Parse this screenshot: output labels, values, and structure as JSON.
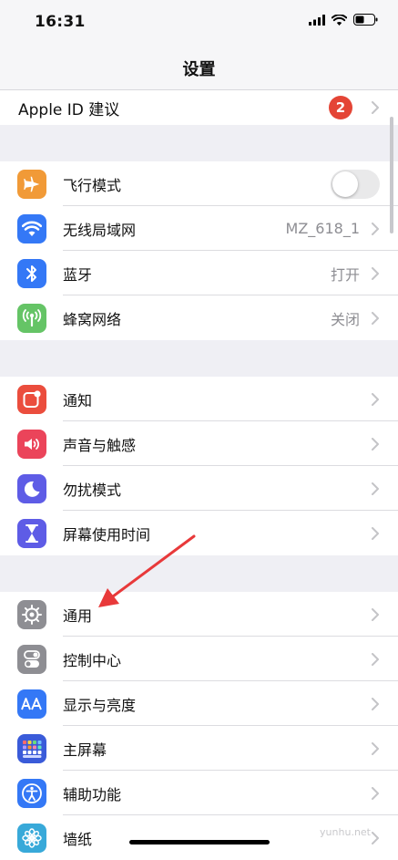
{
  "status_bar": {
    "time": "16:31"
  },
  "nav": {
    "title": "设置"
  },
  "top_row": {
    "label": "Apple ID 建议",
    "badge": "2"
  },
  "group1": [
    {
      "label": "飞行模式",
      "icon": "airplane-icon",
      "color": "#f19a37",
      "toggle": false
    },
    {
      "label": "无线局域网",
      "icon": "wifi-icon",
      "color": "#3478f6",
      "value": "MZ_618_1"
    },
    {
      "label": "蓝牙",
      "icon": "bluetooth-icon",
      "color": "#3478f6",
      "value": "打开"
    },
    {
      "label": "蜂窝网络",
      "icon": "cellular-icon",
      "color": "#65c466",
      "value": "关闭"
    }
  ],
  "group2": [
    {
      "label": "通知",
      "icon": "notification-icon",
      "color": "#eb4d3d"
    },
    {
      "label": "声音与触感",
      "icon": "sound-icon",
      "color": "#eb445a"
    },
    {
      "label": "勿扰模式",
      "icon": "moon-icon",
      "color": "#5e5ce6"
    },
    {
      "label": "屏幕使用时间",
      "icon": "hourglass-icon",
      "color": "#5e5ce6"
    }
  ],
  "group3": [
    {
      "label": "通用",
      "icon": "gear-icon",
      "color": "#8e8e93"
    },
    {
      "label": "控制中心",
      "icon": "toggles-icon",
      "color": "#8e8e93"
    },
    {
      "label": "显示与亮度",
      "icon": "text-size-icon",
      "color": "#3478f6"
    },
    {
      "label": "主屏幕",
      "icon": "home-grid-icon",
      "color": "#3a5bd9"
    },
    {
      "label": "辅助功能",
      "icon": "accessibility-icon",
      "color": "#3478f6"
    },
    {
      "label": "墙纸",
      "icon": "wallpaper-icon",
      "color": "#38a9d9"
    }
  ],
  "watermark": "yunhu.net",
  "annotation_color": "#e8393a"
}
